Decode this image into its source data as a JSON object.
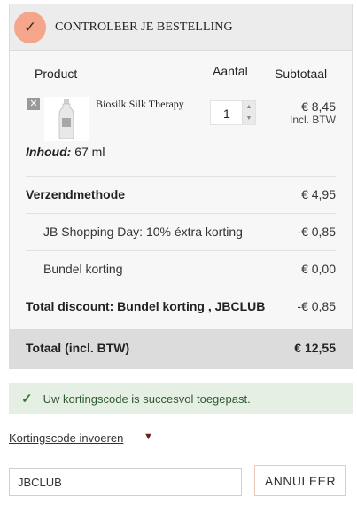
{
  "checkout": {
    "title": "CONTROLEER JE BESTELLING",
    "check_glyph": "✓",
    "columns": {
      "product": "Product",
      "qty": "Aantal",
      "subtotal": "Subtotaal"
    },
    "item": {
      "remove_glyph": "✕",
      "name": "Biosilk Silk Therapy",
      "qty": "1",
      "price": "€ 8,45",
      "vat_note": "Incl. BTW",
      "content_label": "Inhoud:",
      "content_value": " 67 ml"
    },
    "rows": [
      {
        "label": "Verzendmethode",
        "value": "€ 4,95"
      },
      {
        "label": "JB Shopping Day: 10% éxtra korting",
        "value": "-€ 0,85"
      },
      {
        "label": "Bundel korting",
        "value": "€ 0,00"
      },
      {
        "label": "Total discount: Bundel korting , JBCLUB",
        "value": "-€ 0,85"
      }
    ],
    "total": {
      "label": "Totaal (incl. BTW)",
      "value": "€ 12,55"
    }
  },
  "notice": {
    "tick": "✓",
    "text": "Uw kortingscode is succesvol toegepast."
  },
  "coupon": {
    "link_label": "Kortingscode invoeren",
    "chevron": "▼",
    "input_value": "JBCLUB",
    "cancel_label": "ANNULEER"
  },
  "colors": {
    "accent_circle": "#f4a58a",
    "success_bg": "#e6efe4",
    "total_bg": "#dcdcdc"
  },
  "icons": [
    "checkmark-icon",
    "remove-icon",
    "spinner-up-icon",
    "spinner-down-icon",
    "chevron-down-icon"
  ]
}
